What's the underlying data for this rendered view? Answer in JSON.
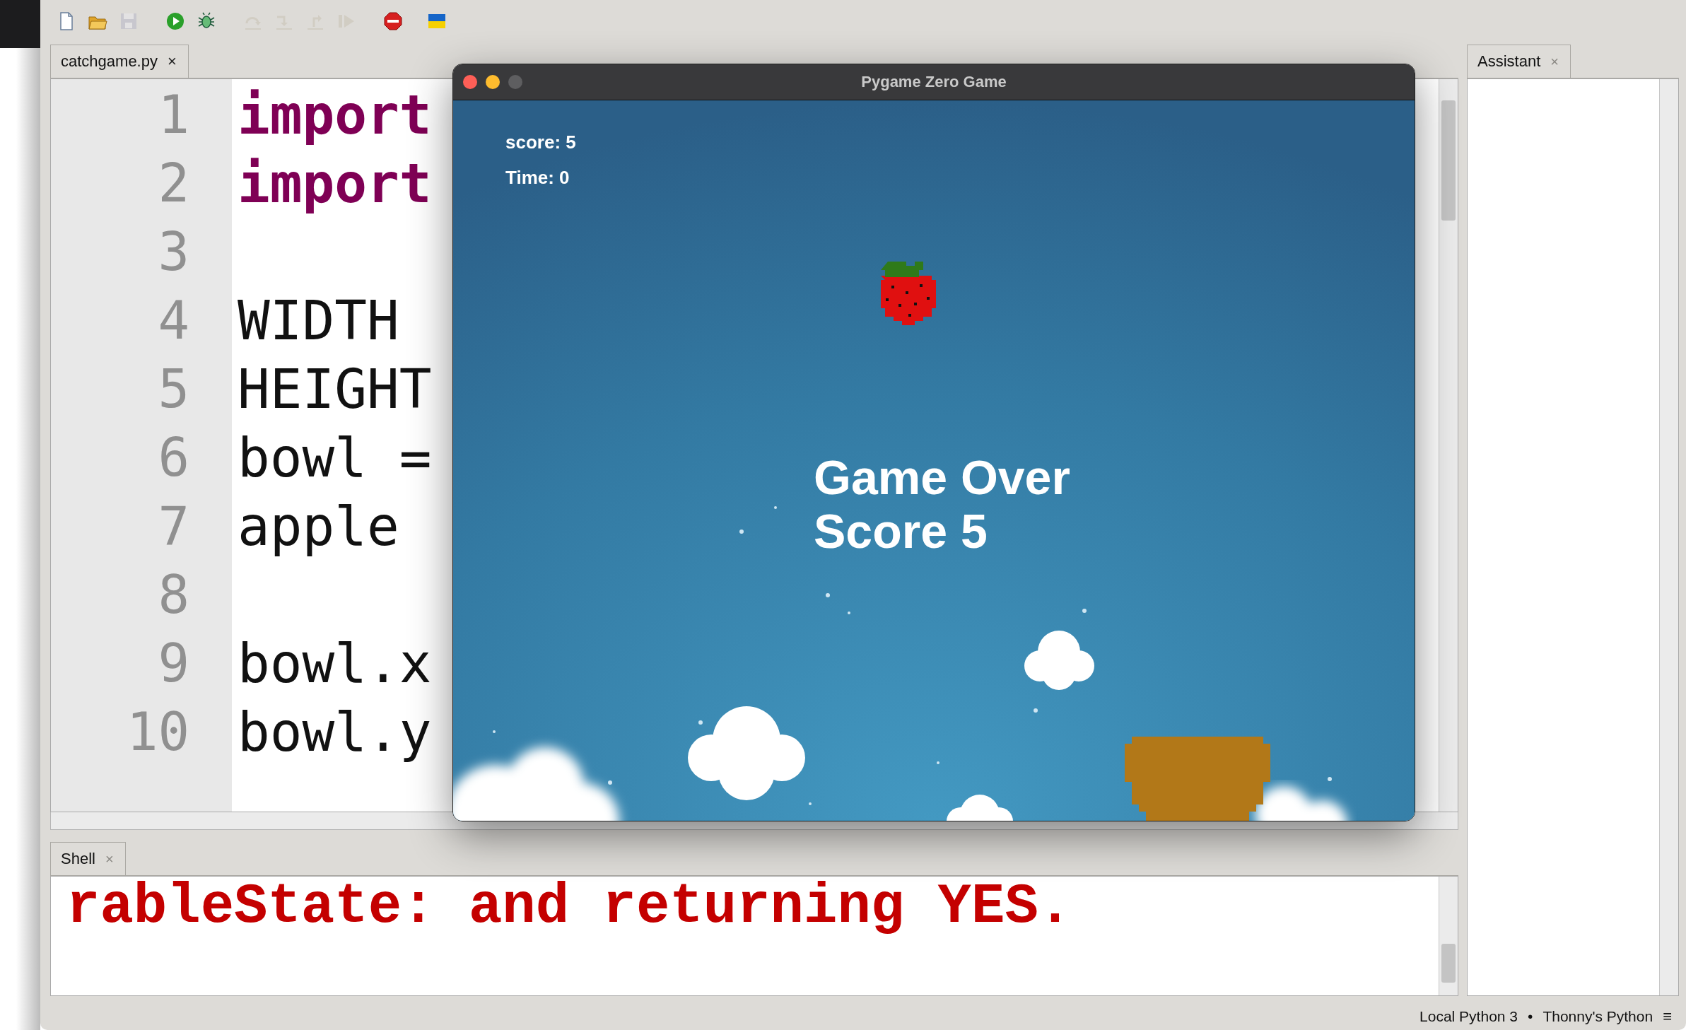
{
  "toolbar": [
    {
      "kind": "new",
      "disabled": false
    },
    {
      "kind": "open",
      "disabled": false
    },
    {
      "kind": "save",
      "disabled": true
    },
    {
      "kind": "run",
      "disabled": false
    },
    {
      "kind": "debug",
      "disabled": false
    },
    {
      "kind": "step_over",
      "disabled": true
    },
    {
      "kind": "step_into",
      "disabled": true
    },
    {
      "kind": "step_out",
      "disabled": true
    },
    {
      "kind": "resume",
      "disabled": true
    },
    {
      "kind": "stop",
      "disabled": false
    },
    {
      "kind": "flag",
      "disabled": false
    }
  ],
  "editor": {
    "tab": {
      "label": "catchgame.py",
      "close": "×"
    },
    "lines": [
      {
        "number": "1",
        "text": "import",
        "kind": "keyword"
      },
      {
        "number": "2",
        "text": "import",
        "kind": "keyword"
      },
      {
        "number": "3"
      },
      {
        "number": "4",
        "text": "WIDTH",
        "kind": "plain"
      },
      {
        "number": "5",
        "text": "HEIGHT",
        "kind": "plain"
      },
      {
        "number": "6",
        "text": "bowl =",
        "kind": "plain"
      },
      {
        "number": "7",
        "text": "apple",
        "kind": "plain"
      },
      {
        "number": "8"
      },
      {
        "number": "9",
        "text": "bowl.x",
        "kind": "plain"
      },
      {
        "number": "10",
        "text": "bowl.y",
        "kind": "plain"
      }
    ]
  },
  "shell": {
    "tab": {
      "label": "Shell",
      "close": "×"
    },
    "output": "rableState: and returning YES."
  },
  "assistant": {
    "tab": {
      "label": "Assistant",
      "close": "×"
    }
  },
  "status_bar": {
    "interpreter": "Local Python 3",
    "separator": "•",
    "environment": "Thonny's Python",
    "menu": "≡"
  },
  "game_window": {
    "title": "Pygame Zero Game",
    "window_buttons": [
      {
        "kind": "close"
      },
      {
        "kind": "minimize"
      },
      {
        "kind": "zoom"
      }
    ],
    "hud": [
      "score: 5",
      "Time: 0"
    ],
    "message": [
      "Game Over",
      "Score 5"
    ]
  }
}
